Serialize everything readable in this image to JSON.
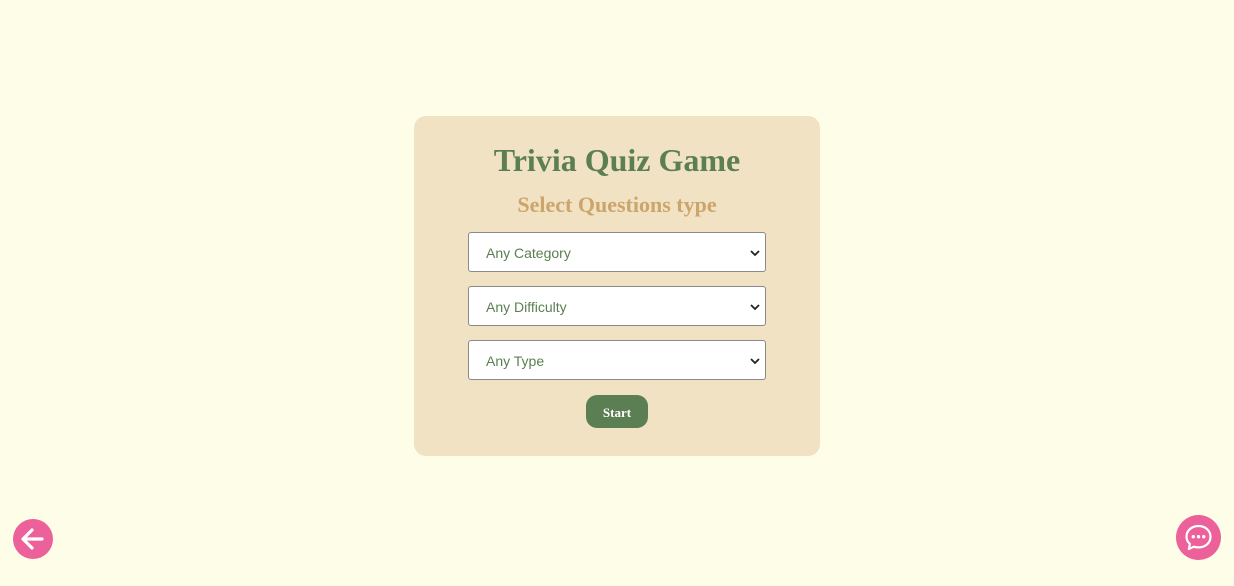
{
  "quiz": {
    "title": "Trivia Quiz Game",
    "subtitle": "Select Questions type",
    "category_select": {
      "selected": "Any Category"
    },
    "difficulty_select": {
      "selected": "Any Difficulty"
    },
    "type_select": {
      "selected": "Any Type"
    },
    "start_label": "Start"
  },
  "floating_buttons": {
    "back": {
      "icon": "arrow-left-icon"
    },
    "chat": {
      "icon": "chat-bubble-icon"
    }
  },
  "colors": {
    "background": "#fefee8",
    "card": "#f0e2c2",
    "primary_green": "#5b7f52",
    "subtitle_tan": "#cca56c",
    "accent_pink": "#ec6199"
  }
}
